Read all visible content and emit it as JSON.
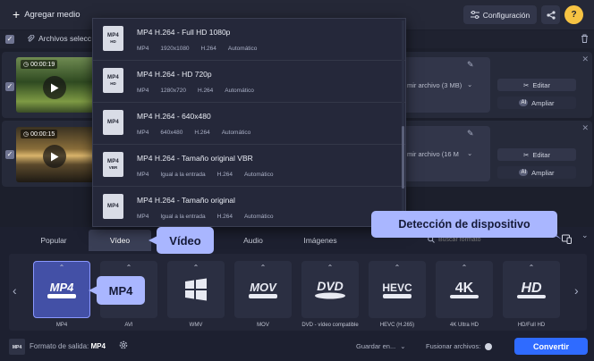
{
  "toolbar": {
    "add_media": "Agregar medio",
    "settings": "Configuración",
    "help": "?"
  },
  "selection": {
    "files_selected": "Archivos selecc"
  },
  "files": [
    {
      "duration": "00:00:19",
      "output": "mir archivo (3 MB)",
      "edit": "Editar",
      "enhance": "Ampliar"
    },
    {
      "duration": "00:00:15",
      "output": "mir archivo (16 M",
      "edit": "Editar",
      "enhance": "Ampliar"
    }
  ],
  "presets": [
    {
      "title": "MP4 H.264 - Full HD 1080p",
      "icon_text": "MP4",
      "icon_sub": "HD",
      "container": "MP4",
      "resolution": "1920x1080",
      "codec": "H.264",
      "bitrate": "Automático"
    },
    {
      "title": "MP4 H.264 - HD 720p",
      "icon_text": "MP4",
      "icon_sub": "HD",
      "container": "MP4",
      "resolution": "1280x720",
      "codec": "H.264",
      "bitrate": "Automático"
    },
    {
      "title": "MP4 H.264 - 640x480",
      "icon_text": "MP4",
      "icon_sub": "",
      "container": "MP4",
      "resolution": "640x480",
      "codec": "H.264",
      "bitrate": "Automático"
    },
    {
      "title": "MP4 H.264 - Tamaño original VBR",
      "icon_text": "MP4",
      "icon_sub": "VBR",
      "container": "MP4",
      "resolution": "Igual a la entrada",
      "codec": "H.264",
      "bitrate": "Automático"
    },
    {
      "title": "MP4 H.264 - Tamaño original",
      "icon_text": "MP4",
      "icon_sub": "",
      "container": "MP4",
      "resolution": "Igual a la entrada",
      "codec": "H.264",
      "bitrate": "Automático"
    }
  ],
  "tabs": [
    "Popular",
    "Vídeo",
    "Audio",
    "Imágenes"
  ],
  "search": {
    "placeholder": "Buscar formato"
  },
  "formats": [
    {
      "label": "MP4",
      "logo": "MP4"
    },
    {
      "label": "AVI",
      "logo": "AVI"
    },
    {
      "label": "WMV",
      "logo": "windows-logo"
    },
    {
      "label": "MOV",
      "logo": "MOV"
    },
    {
      "label": "DVD - vídeo compatible",
      "logo": "DVD"
    },
    {
      "label": "HEVC (H.265)",
      "logo": "HEVC"
    },
    {
      "label": "4K Ultra HD",
      "logo": "4K"
    },
    {
      "label": "HD/Full HD",
      "logo": "HD"
    }
  ],
  "bottom": {
    "output_label": "Formato de salida:",
    "output_value": "MP4",
    "save_in": "Guardar en...",
    "merge": "Fusionar archivos:",
    "convert": "Convertir"
  },
  "callouts": {
    "video": "Vídeo",
    "mp4": "MP4",
    "device": "Detección de dispositivo"
  },
  "colors": {
    "accent": "#2f6bff",
    "callout": "#a9b6ff",
    "help": "#f6c343",
    "selected_format": "#4350a6"
  }
}
